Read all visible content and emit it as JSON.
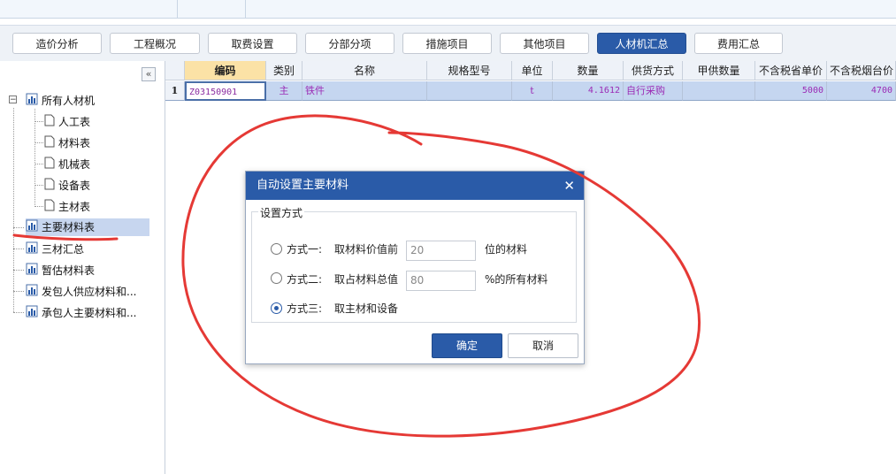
{
  "tabs": [
    {
      "label": "造价分析",
      "active": false
    },
    {
      "label": "工程概况",
      "active": false
    },
    {
      "label": "取费设置",
      "active": false
    },
    {
      "label": "分部分项",
      "active": false
    },
    {
      "label": "措施项目",
      "active": false
    },
    {
      "label": "其他项目",
      "active": false
    },
    {
      "label": "人材机汇总",
      "active": true
    },
    {
      "label": "费用汇总",
      "active": false
    }
  ],
  "sidebar": {
    "collapse_glyph": "«",
    "root": "所有人材机",
    "children": [
      "人工表",
      "材料表",
      "机械表",
      "设备表",
      "主材表"
    ],
    "items": [
      "主要材料表",
      "三材汇总",
      "暂估材料表",
      "发包人供应材料和...",
      "承包人主要材料和..."
    ],
    "selected": "主要材料表"
  },
  "grid": {
    "headers": [
      "编码",
      "类别",
      "名称",
      "规格型号",
      "单位",
      "数量",
      "供货方式",
      "甲供数量",
      "不含税省单价",
      "不含税烟台价"
    ],
    "rows": [
      {
        "num": "1",
        "code": "Z03150901",
        "type": "主",
        "name": "铁件",
        "spec": "",
        "unit": "t",
        "qty": "4.1612",
        "supply": "自行采购",
        "owner_qty": "",
        "price_province": "5000",
        "price_yantai": "4700"
      }
    ]
  },
  "dialog": {
    "title": "自动设置主要材料",
    "close_glyph": "✕",
    "group_label": "设置方式",
    "options": [
      {
        "label": "方式一:",
        "desc": "取材料价值前",
        "value": "20",
        "suffix": "位的材料",
        "checked": false
      },
      {
        "label": "方式二:",
        "desc": "取占材料总值",
        "value": "80",
        "suffix": "%的所有材料",
        "checked": false
      },
      {
        "label": "方式三:",
        "desc": "取主材和设备",
        "checked": true
      }
    ],
    "ok": "确定",
    "cancel": "取消"
  },
  "colors": {
    "accent": "#2a5ba8",
    "annotation": "#e53935",
    "selected_row": "#c5d6f0",
    "active_header": "#fbe2a6",
    "text_purple": "#9b2bb5"
  }
}
